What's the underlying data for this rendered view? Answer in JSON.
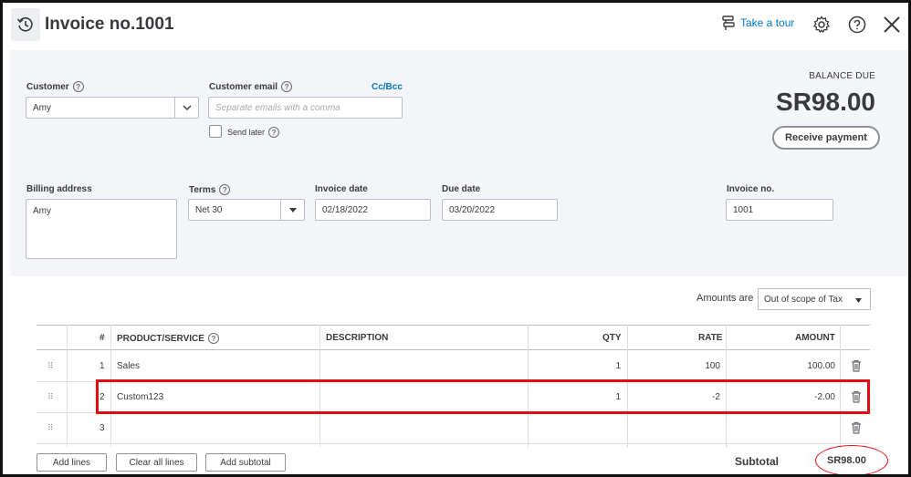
{
  "header": {
    "title": "Invoice no.1001",
    "take_tour": "Take a tour",
    "icons": [
      "history-icon",
      "tour-icon",
      "gear-icon",
      "help-icon",
      "close-icon"
    ]
  },
  "customer": {
    "label": "Customer",
    "value": "Amy"
  },
  "customer_email": {
    "label": "Customer email",
    "placeholder": "Separate emails with a comma",
    "cc_bcc": "Cc/Bcc",
    "send_later": "Send later"
  },
  "balance": {
    "label": "BALANCE DUE",
    "amount": "SR98.00",
    "receive_payment": "Receive payment"
  },
  "billing": {
    "label": "Billing address",
    "value": "Amy"
  },
  "terms": {
    "label": "Terms",
    "value": "Net 30"
  },
  "invoice_date": {
    "label": "Invoice date",
    "value": "02/18/2022"
  },
  "due_date": {
    "label": "Due date",
    "value": "03/20/2022"
  },
  "invoice_no": {
    "label": "Invoice no.",
    "value": "1001"
  },
  "amounts_are": {
    "label": "Amounts are",
    "value": "Out of scope of Tax"
  },
  "table": {
    "headers": {
      "num": "#",
      "product": "PRODUCT/SERVICE",
      "description": "DESCRIPTION",
      "qty": "QTY",
      "rate": "RATE",
      "amount": "AMOUNT"
    },
    "rows": [
      {
        "num": "1",
        "product": "Sales",
        "description": "",
        "qty": "1",
        "rate": "100",
        "amount": "100.00"
      },
      {
        "num": "2",
        "product": "Custom123",
        "description": "",
        "qty": "1",
        "rate": "-2",
        "amount": "-2.00"
      },
      {
        "num": "3",
        "product": "",
        "description": "",
        "qty": "",
        "rate": "",
        "amount": ""
      }
    ]
  },
  "footer": {
    "add_lines": "Add lines",
    "clear_all_lines": "Clear all lines",
    "add_subtotal": "Add subtotal",
    "subtotal_label": "Subtotal",
    "subtotal_value": "SR98.00"
  },
  "colors": {
    "accent": "#0077c5",
    "highlight": "#e20d12",
    "form_bg": "#f4f5f8"
  }
}
